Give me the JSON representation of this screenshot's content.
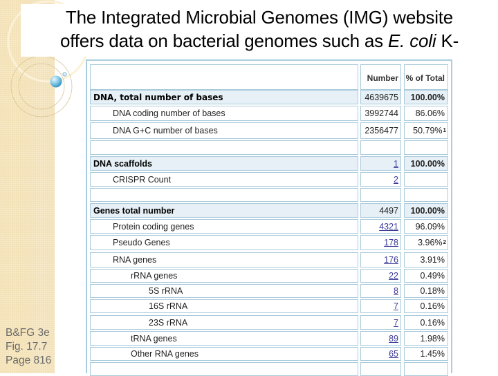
{
  "slide": {
    "title_line1": "The Integrated Microbial Genomes (IMG) website",
    "title_line2_prefix": "offers data on bacterial genomes such as ",
    "title_line2_italic": "E. coli",
    "title_line2_suffix": " K-",
    "caption": [
      "B&FG 3e",
      "Fig. 17.7",
      "Page 816"
    ]
  },
  "colors": {
    "sidebar": "#f3e1b6",
    "table_border": "#a8cadb",
    "section_row_bg": "#e6f0f6",
    "link": "#3a3a9a",
    "caption": "#6b6b6b"
  },
  "table": {
    "columns": [
      "",
      "Number",
      "% of Total"
    ],
    "rows": [
      {
        "label": "DNA, total number of bases",
        "number": "4639675",
        "pct": "100.00%",
        "sup": "",
        "type": "section",
        "indent": 0,
        "link": false
      },
      {
        "label": "DNA coding number of bases",
        "number": "3992744",
        "pct": "86.06%",
        "sup": "",
        "type": "normal",
        "indent": 1,
        "link": false
      },
      {
        "label": "DNA G+C number of bases",
        "number": "2356477",
        "pct": "50.79%",
        "sup": "1",
        "type": "normal",
        "indent": 1,
        "link": false
      },
      {
        "label": "",
        "number": "",
        "pct": "",
        "sup": "",
        "type": "blank",
        "indent": 0,
        "link": false
      },
      {
        "label": "DNA scaffolds",
        "number": "1",
        "pct": "100.00%",
        "sup": "",
        "type": "section",
        "indent": 0,
        "link": true
      },
      {
        "label": "CRISPR Count",
        "number": "2",
        "pct": "",
        "sup": "",
        "type": "normal",
        "indent": 1,
        "link": true
      },
      {
        "label": "",
        "number": "",
        "pct": "",
        "sup": "",
        "type": "blank",
        "indent": 0,
        "link": false
      },
      {
        "label": "Genes total number",
        "number": "4497",
        "pct": "100.00%",
        "sup": "",
        "type": "section",
        "indent": 0,
        "link": false
      },
      {
        "label": "Protein coding genes",
        "number": "4321",
        "pct": "96.09%",
        "sup": "",
        "type": "normal",
        "indent": 1,
        "link": true
      },
      {
        "label": "Pseudo Genes",
        "number": "178",
        "pct": "3.96%",
        "sup": "2",
        "type": "normal",
        "indent": 1,
        "link": true
      },
      {
        "label": "RNA genes",
        "number": "176",
        "pct": "3.91%",
        "sup": "",
        "type": "normal",
        "indent": 1,
        "link": true
      },
      {
        "label": "rRNA genes",
        "number": "22",
        "pct": "0.49%",
        "sup": "",
        "type": "normal",
        "indent": 2,
        "link": true
      },
      {
        "label": "5S rRNA",
        "number": "8",
        "pct": "0.18%",
        "sup": "",
        "type": "normal",
        "indent": 3,
        "link": true
      },
      {
        "label": "16S rRNA",
        "number": "7",
        "pct": "0.16%",
        "sup": "",
        "type": "normal",
        "indent": 3,
        "link": true
      },
      {
        "label": "23S rRNA",
        "number": "7",
        "pct": "0.16%",
        "sup": "",
        "type": "normal",
        "indent": 3,
        "link": true
      },
      {
        "label": "tRNA genes",
        "number": "89",
        "pct": "1.98%",
        "sup": "",
        "type": "normal",
        "indent": 2,
        "link": true
      },
      {
        "label": "Other RNA genes",
        "number": "65",
        "pct": "1.45%",
        "sup": "",
        "type": "normal",
        "indent": 2,
        "link": true
      }
    ]
  }
}
